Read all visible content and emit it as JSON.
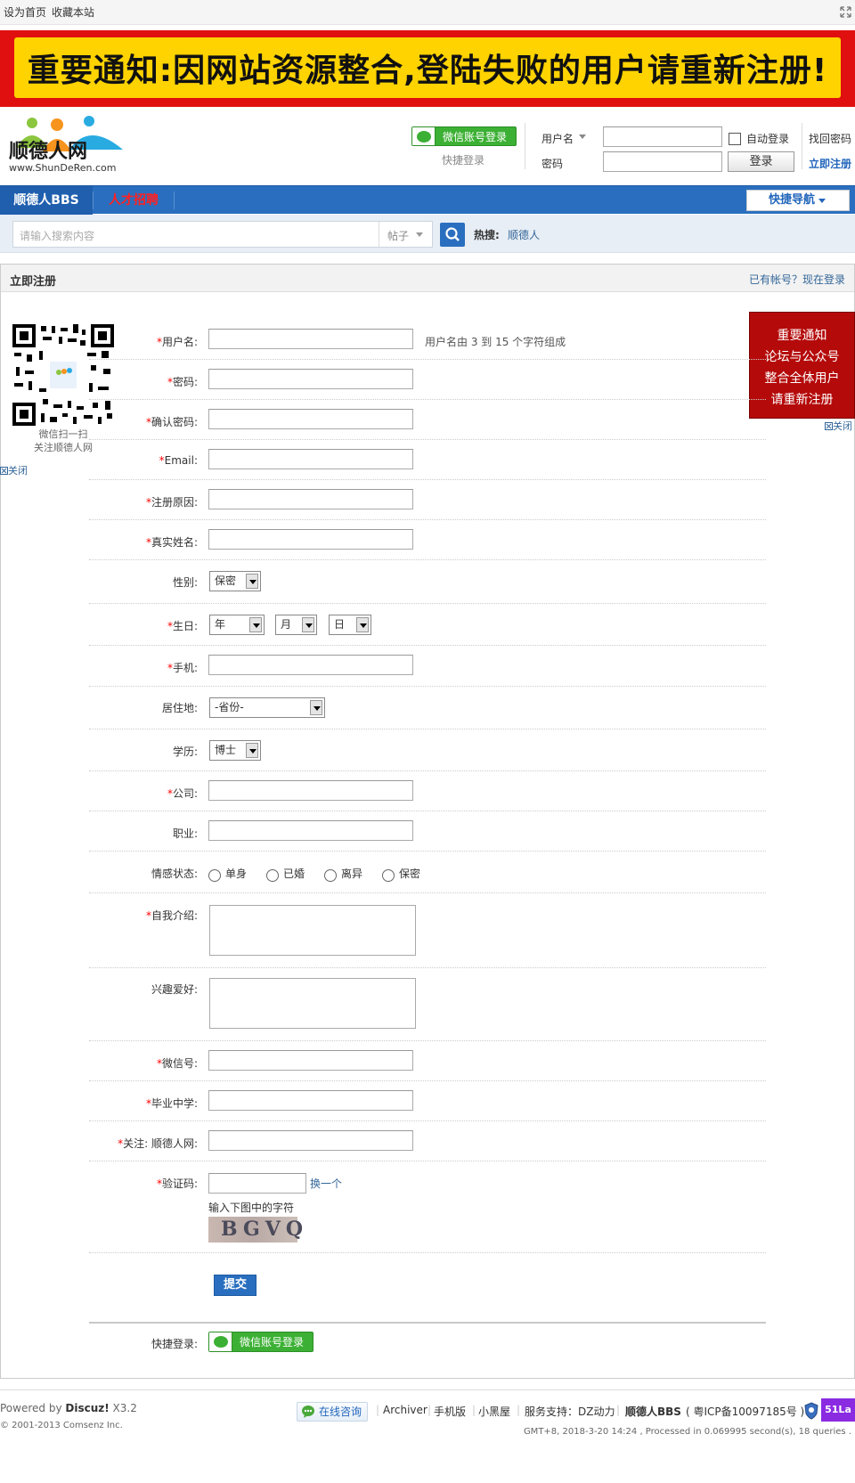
{
  "topbar": {
    "set_home": "设为首页",
    "bookmark": "收藏本站"
  },
  "banner": {
    "text": "重要通知:因网站资源整合,登陆失败的用户请重新注册!"
  },
  "logo": {
    "name": "顺德人网",
    "url": "www.ShunDeRen.com"
  },
  "header": {
    "wechat_login": "微信账号登录",
    "quick_login": "快捷登录",
    "username_label": "用户名",
    "password_label": "密码",
    "auto_login": "自动登录",
    "login_button": "登录",
    "find_password": "找回密码",
    "register_now": "立即注册"
  },
  "nav": {
    "items": [
      "顺德人BBS",
      "人才招聘"
    ],
    "quick_nav": "快捷导航"
  },
  "search": {
    "placeholder": "请输入搜索内容",
    "type": "帖子",
    "hot_label": "热搜:",
    "hot_item": "顺德人"
  },
  "panel": {
    "title": "立即注册",
    "have_account": "已有帐号？现在登录"
  },
  "qr": {
    "line1": "微信扫一扫",
    "line2": "关注顺德人网",
    "close": "关闭"
  },
  "notice": {
    "lines": [
      "重要通知",
      "论坛与公众号",
      "整合全体用户",
      "请重新注册"
    ],
    "close": "关闭"
  },
  "form": {
    "username": "用户名:",
    "username_hint": "用户名由 3 到 15 个字符组成",
    "password": "密码:",
    "confirm_password": "确认密码:",
    "email": "Email:",
    "reason": "注册原因:",
    "realname": "真实姓名:",
    "gender": "性别:",
    "gender_value": "保密",
    "birthday": "生日:",
    "year": "年",
    "month": "月",
    "day": "日",
    "mobile": "手机:",
    "residence": "居住地:",
    "province": "-省份-",
    "education": "学历:",
    "education_value": "博士",
    "company": "公司:",
    "occupation": "职业:",
    "marital": "情感状态:",
    "marital_options": [
      "单身",
      "已婚",
      "离异",
      "保密"
    ],
    "bio": "自我介绍:",
    "interests": "兴趣爱好:",
    "wechat": "微信号:",
    "middle_school": "毕业中学:",
    "follow": "关注: 顺德人网:",
    "captcha": "验证码:",
    "captcha_change": "换一个",
    "captcha_hint": "输入下图中的字符",
    "captcha_text": "BGVQ",
    "submit": "提交",
    "quick_login": "快捷登录:",
    "wechat_login": "微信账号登录"
  },
  "footer": {
    "powered_prefix": "Powered by ",
    "powered_brand": "Discuz!",
    "powered_version": " X3.2",
    "copyright": "© 2001-2013 Comsenz Inc.",
    "consult": "在线咨询",
    "links": [
      "Archiver",
      "手机版",
      "小黑屋"
    ],
    "support": "服务支持：DZ动力",
    "site": "顺德人BBS",
    "icp": "( 粤ICP备10097185号 )",
    "stats": "51La",
    "gmt": "GMT+8, 2018-3-20 14:24 , Processed in 0.069995 second(s), 18 queries ."
  }
}
